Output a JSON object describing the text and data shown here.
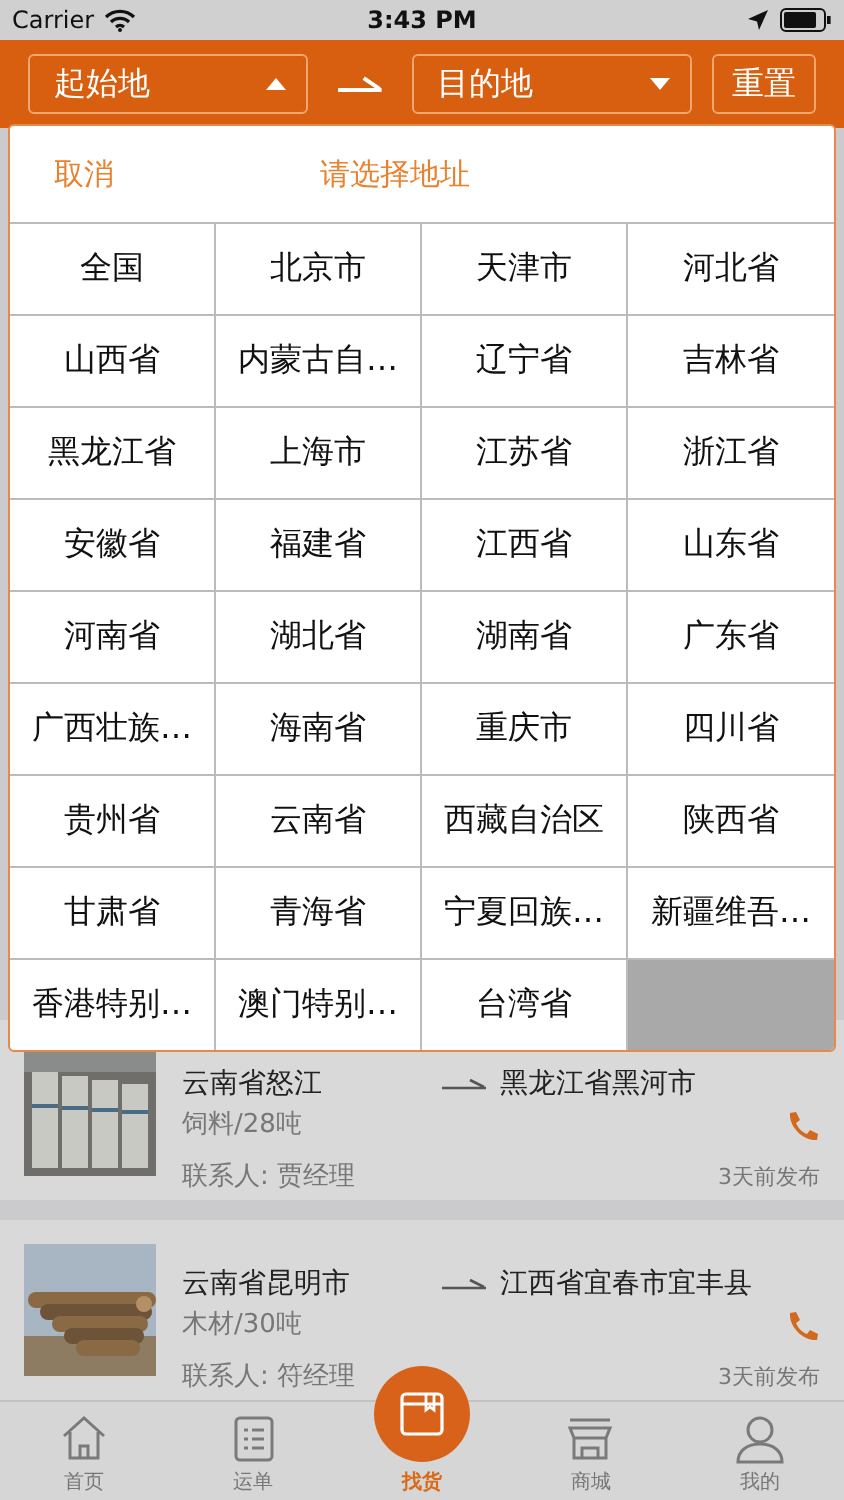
{
  "status_bar": {
    "carrier": "Carrier",
    "time": "3:43 PM"
  },
  "filter": {
    "origin": {
      "label": "起始地",
      "expanded": true
    },
    "destination": {
      "label": "目的地",
      "expanded": false
    },
    "reset": "重置"
  },
  "picker": {
    "cancel": "取消",
    "title": "请选择地址",
    "cells": [
      "全国",
      "北京市",
      "天津市",
      "河北省",
      "山西省",
      "内蒙古自…",
      "辽宁省",
      "吉林省",
      "黑龙江省",
      "上海市",
      "江苏省",
      "浙江省",
      "安徽省",
      "福建省",
      "江西省",
      "山东省",
      "河南省",
      "湖北省",
      "湖南省",
      "广东省",
      "广西壮族…",
      "海南省",
      "重庆市",
      "四川省",
      "贵州省",
      "云南省",
      "西藏自治区",
      "陕西省",
      "甘肃省",
      "青海省",
      "宁夏回族…",
      "新疆维吾…",
      "香港特别…",
      "澳门特别…",
      "台湾省"
    ]
  },
  "listings": [
    {
      "kind": "picture",
      "from": "云南省怒江",
      "to": "黑龙江省黑河市",
      "cargo": "饲料/28吨",
      "contact": "联系人: 贾经理",
      "posted": "3天前发布"
    },
    {
      "kind": "picture",
      "from": "云南省昆明市",
      "to": "江西省宜春市宜丰县",
      "cargo": "木材/30吨",
      "contact": "联系人: 符经理",
      "posted": "3天前发布"
    }
  ],
  "tab_bar": [
    {
      "label": "首页",
      "kind": "home",
      "selected": false
    },
    {
      "label": "运单",
      "kind": "list",
      "selected": false
    },
    {
      "label": "找货",
      "kind": "box",
      "selected": true
    },
    {
      "label": "商城",
      "kind": "shop",
      "selected": false
    },
    {
      "label": "我的",
      "kind": "user",
      "selected": false
    }
  ]
}
